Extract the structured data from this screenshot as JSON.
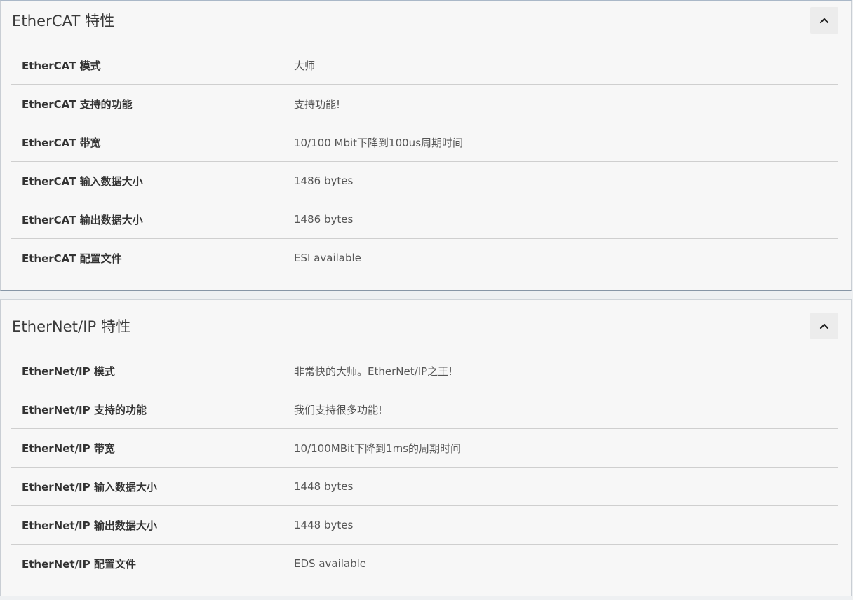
{
  "sections": [
    {
      "title": "EtherCAT 特性",
      "collapse_icon": "chevron-up-icon",
      "rows": [
        {
          "label": "EtherCAT 模式",
          "value": "大师"
        },
        {
          "label": "EtherCAT 支持的功能",
          "value": "支持功能!"
        },
        {
          "label": "EtherCAT 带宽",
          "value": "10/100 Mbit下降到100us周期时间"
        },
        {
          "label": "EtherCAT 输入数据大小",
          "value": "1486 bytes"
        },
        {
          "label": "EtherCAT 输出数据大小",
          "value": "1486 bytes"
        },
        {
          "label": "EtherCAT 配置文件",
          "value": "ESI available"
        }
      ]
    },
    {
      "title": "EtherNet/IP 特性",
      "collapse_icon": "chevron-up-icon",
      "rows": [
        {
          "label": "EtherNet/IP 模式",
          "value": "非常快的大师。EtherNet/IP之王!"
        },
        {
          "label": "EtherNet/IP 支持的功能",
          "value": "我们支持很多功能!"
        },
        {
          "label": "EtherNet/IP 带宽",
          "value": "10/100MBit下降到1ms的周期时间"
        },
        {
          "label": "EtherNet/IP 输入数据大小",
          "value": "1448 bytes"
        },
        {
          "label": "EtherNet/IP 输出数据大小",
          "value": "1448 bytes"
        },
        {
          "label": "EtherNet/IP 配置文件",
          "value": "EDS available"
        }
      ]
    }
  ]
}
